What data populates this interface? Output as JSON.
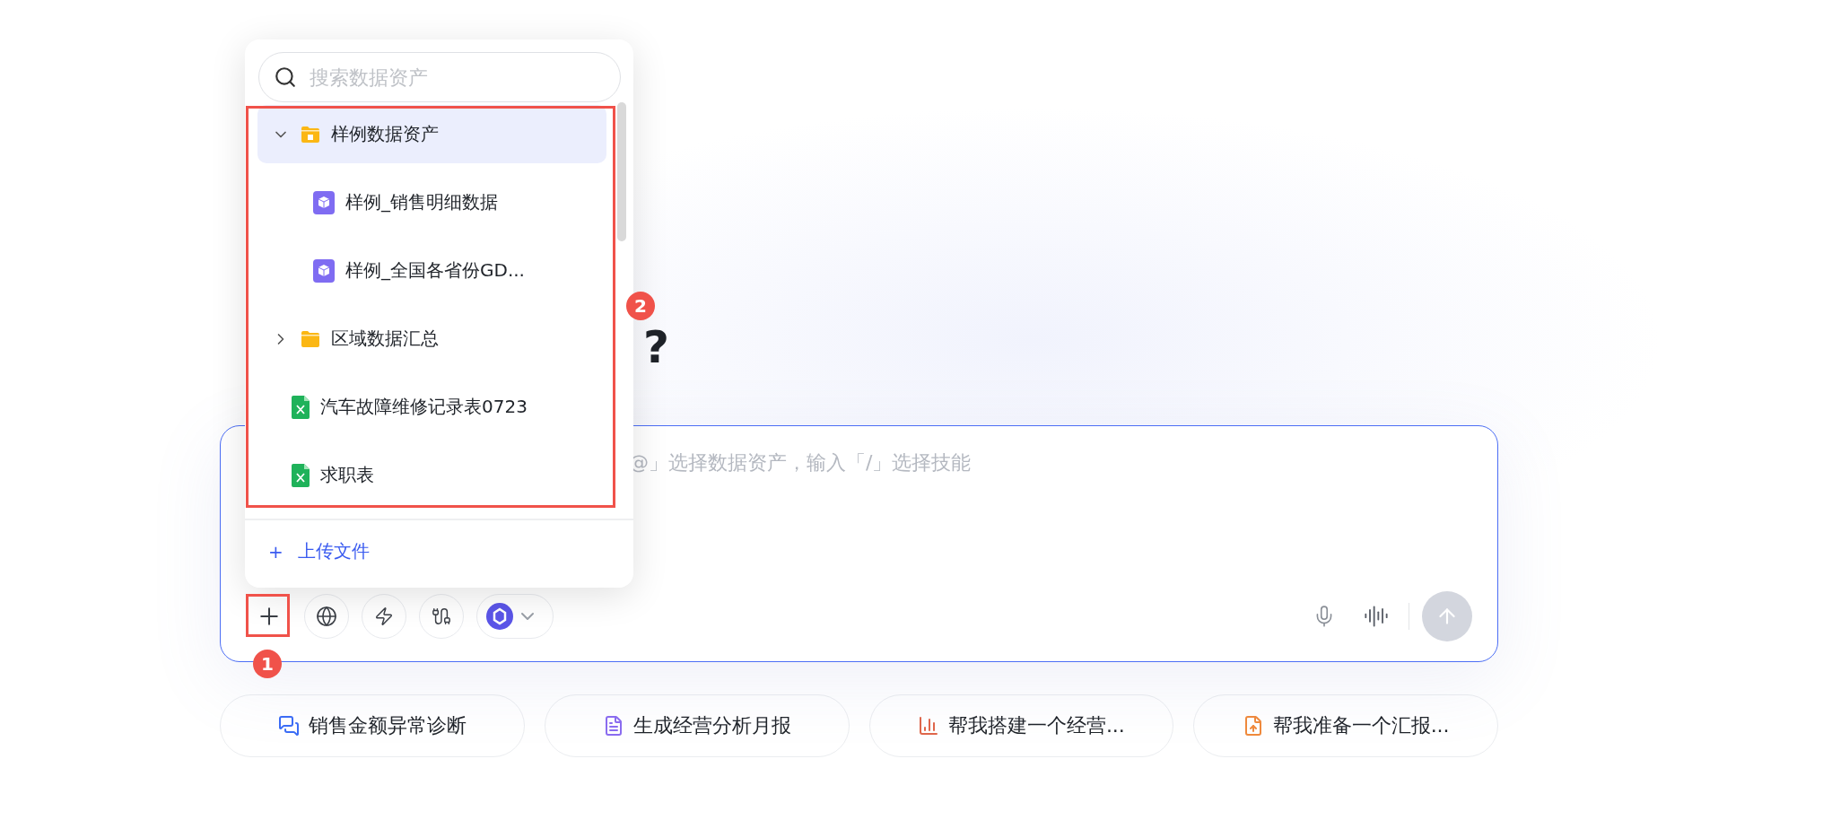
{
  "heading": {
    "line_2_end": "?"
  },
  "composer": {
    "placeholder": "@」选择数据资产，输入「/」选择技能"
  },
  "asset_picker": {
    "search": {
      "placeholder": "搜索数据资产"
    },
    "items": [
      {
        "name": "样例数据资产",
        "kind": "folder",
        "selected": true,
        "expanded": true,
        "children": [
          {
            "name": "样例_销售明细数据",
            "kind": "dataset",
            "selected": false
          },
          {
            "name": "样例_全国各省份GD...",
            "kind": "dataset",
            "selected": false
          }
        ]
      },
      {
        "name": "区域数据汇总",
        "kind": "folder",
        "selected": false,
        "expanded": false
      },
      {
        "name": "汽车故障维修记录表0723",
        "kind": "sheet",
        "selected": false
      },
      {
        "name": "求职表",
        "kind": "sheet",
        "selected": false
      }
    ],
    "upload": {
      "icon": "+",
      "label": "上传文件"
    }
  },
  "suggestions": [
    {
      "label": "销售金额异常诊断",
      "kind": "chat",
      "color": "#3b6cf6"
    },
    {
      "label": "生成经营分析月报",
      "kind": "report",
      "color": "#8b6cf0"
    },
    {
      "label": "帮我搭建一个经营...",
      "kind": "chart",
      "color": "#e0664a"
    },
    {
      "label": "帮我准备一个汇报...",
      "kind": "file",
      "color": "#f08a3c"
    }
  ],
  "annotations": [
    {
      "label": "1"
    },
    {
      "label": "2"
    }
  ]
}
